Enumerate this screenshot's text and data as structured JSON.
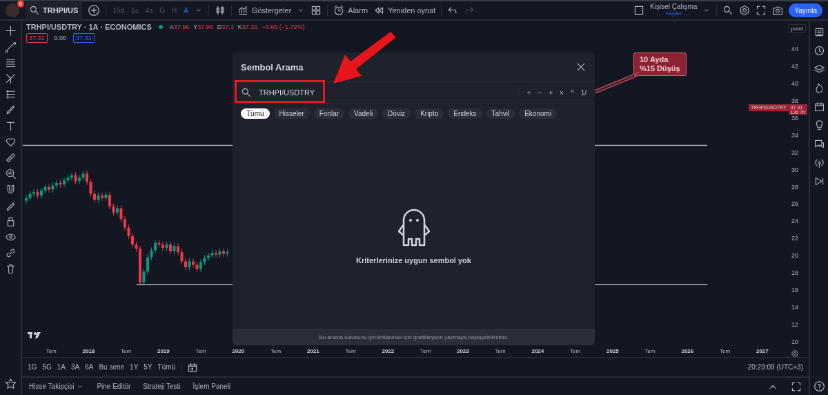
{
  "top_bar": {
    "notification_count": "6",
    "symbol": "TRHPI/US",
    "intervals": [
      {
        "label": "15d",
        "selected": false
      },
      {
        "label": "1s",
        "selected": false
      },
      {
        "label": "4s",
        "selected": false
      },
      {
        "label": "G",
        "selected": false
      },
      {
        "label": "H",
        "selected": false
      },
      {
        "label": "A",
        "selected": true
      }
    ],
    "indicators": "Göstergeler",
    "alarm": "Alarm",
    "replay": "Yeniden oynat",
    "layout_name": "Kişisel Çalışma",
    "layout_status": "Kaydet",
    "publish": "Yayınla"
  },
  "legend": {
    "title": "TRHPI/USDTRY · 1A · ECONOMICS",
    "ohlc": [
      {
        "label": "A",
        "value": "37.96"
      },
      {
        "label": "Y",
        "value": "37.98"
      },
      {
        "label": "D",
        "value": "37.3"
      },
      {
        "label": "K",
        "value": "37.31"
      }
    ],
    "change": "−0.65 (−1.72%)",
    "price_boxes": [
      {
        "text": "37.31",
        "kind": "sell"
      },
      {
        "text": "0.00",
        "kind": "spread"
      },
      {
        "text": "37.31",
        "kind": "buy"
      }
    ]
  },
  "price_axis": {
    "unit": "point",
    "ticks": [
      "44",
      "42",
      "40",
      "38",
      "36",
      "34",
      "32",
      "30",
      "28",
      "26",
      "24",
      "22",
      "20",
      "18",
      "16",
      "14",
      "12",
      "10"
    ],
    "symbol_tag": "TRHPI/USDTRY",
    "last_price": "37.31",
    "countdown": "13d 7h"
  },
  "time_axis": [
    "Tem",
    "2018",
    "Tem",
    "2019",
    "Tem",
    "2020",
    "Tem",
    "2021",
    "Tem",
    "2022",
    "Tem",
    "2023",
    "Tem",
    "2024",
    "Tem",
    "2025",
    "Tem",
    "2026",
    "Tem",
    "2027"
  ],
  "callout": [
    "10 Ayda",
    "%15 Düşüş"
  ],
  "range_bar": {
    "ranges": [
      "1G",
      "5G",
      "1A",
      "3A",
      "6A",
      "Bu sene",
      "1Y",
      "5Y",
      "Tümü"
    ],
    "clock": "20:29:09 (UTC+3)"
  },
  "bottom_panel": [
    {
      "label": "Hisse Takipçisi",
      "has_menu": true
    },
    {
      "label": "Pine Editör",
      "has_menu": false
    },
    {
      "label": "Strateji Testi",
      "has_menu": false
    },
    {
      "label": "İşlem Paneli",
      "has_menu": false
    }
  ],
  "modal": {
    "title": "Sembol Arama",
    "query": "TRHPI/USDTRY",
    "operators": [
      "÷",
      "−",
      "+",
      "×",
      "^",
      "1/"
    ],
    "categories": [
      {
        "label": "Tümü",
        "selected": true
      },
      {
        "label": "Hisseler",
        "selected": false
      },
      {
        "label": "Fonlar",
        "selected": false
      },
      {
        "label": "Vadeli",
        "selected": false
      },
      {
        "label": "Döviz",
        "selected": false
      },
      {
        "label": "Kripto",
        "selected": false
      },
      {
        "label": "Endeks",
        "selected": false
      },
      {
        "label": "Tahvil",
        "selected": false
      },
      {
        "label": "Ekonomi",
        "selected": false
      }
    ],
    "empty_message": "Kriterlerinize uygun sembol yok",
    "footer_hint": "Bu arama kutusunu görüntülemek için grafikteyken yazmaya başlayabilirsiniz."
  }
}
